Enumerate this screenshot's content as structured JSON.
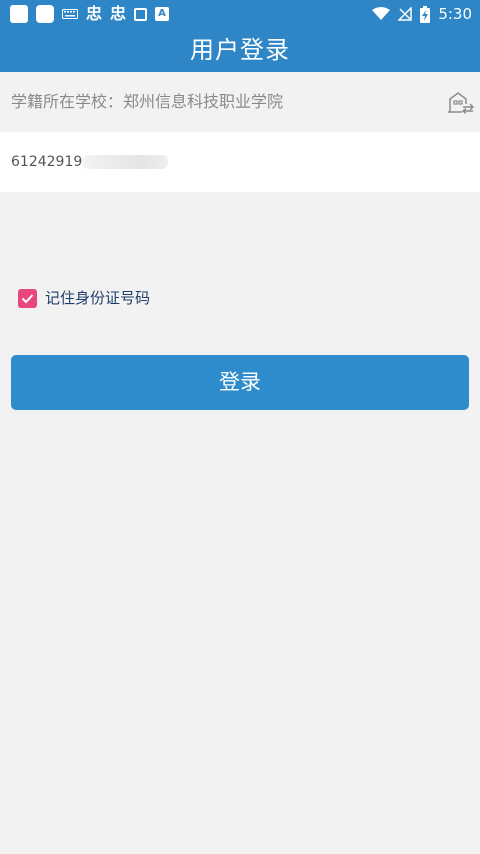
{
  "status_bar": {
    "time": "5:30",
    "notification_glyph_1": "忠",
    "notification_glyph_2": "忠",
    "notification_a": "A",
    "icons": [
      "square-icon",
      "square-icon",
      "keyboard-icon",
      "sim-icon",
      "a-icon",
      "wifi-icon",
      "no-signal-icon",
      "battery-charging-icon"
    ]
  },
  "header": {
    "title": "用户登录"
  },
  "school": {
    "label": "学籍所在学校：郑州信息科技职业学院",
    "icon": "school-building-icon"
  },
  "id_field": {
    "value": "61242919"
  },
  "remember": {
    "checked": true,
    "label": "记住身份证号码"
  },
  "login": {
    "label": "登录"
  },
  "colors": {
    "primary": "#2e86c7",
    "button": "#2f8ccc",
    "checkbox": "#e8467c",
    "background": "#f2f2f2"
  }
}
